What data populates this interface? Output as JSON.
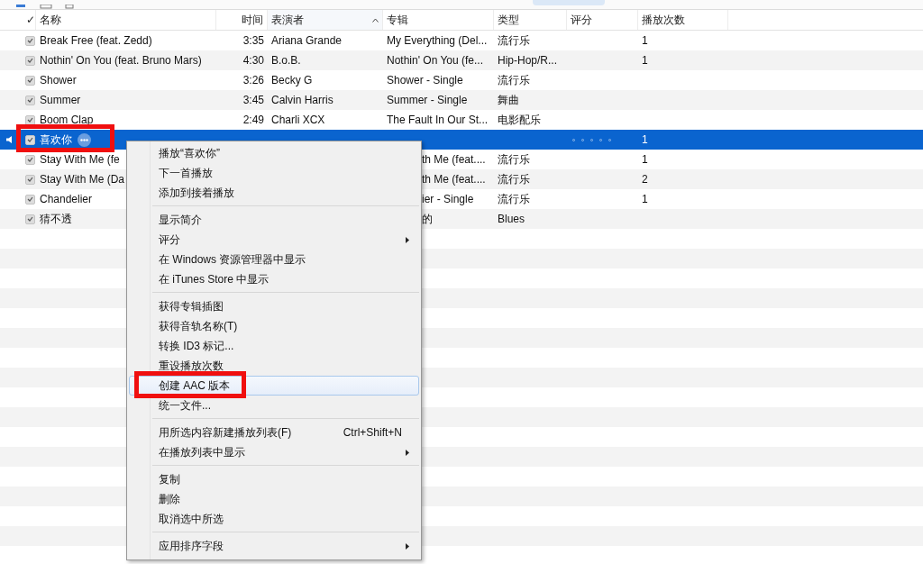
{
  "table": {
    "columns": [
      {
        "label": "✓"
      },
      {
        "label": "名称",
        "sorted": false
      },
      {
        "label": "时间",
        "sorted": false
      },
      {
        "label": "表演者",
        "sorted": true
      },
      {
        "label": "专辑",
        "sorted": false
      },
      {
        "label": "类型",
        "sorted": false
      },
      {
        "label": "评分",
        "sorted": false
      },
      {
        "label": "播放次数",
        "sorted": false
      }
    ],
    "rows": [
      {
        "checked": true,
        "selected": false,
        "playing": false,
        "highlighted": false,
        "name": "Break Free (feat. Zedd)",
        "time": "3:35",
        "artist": "Ariana Grande",
        "album": "My Everything (Del...",
        "genre": "流行乐",
        "plays": "1"
      },
      {
        "checked": true,
        "selected": false,
        "playing": false,
        "highlighted": false,
        "name": "Nothin' On You (feat. Bruno Mars)",
        "time": "4:30",
        "artist": "B.o.B.",
        "album": "Nothin' On You (fe...",
        "genre": "Hip-Hop/R...",
        "plays": "1"
      },
      {
        "checked": true,
        "selected": false,
        "playing": false,
        "highlighted": false,
        "name": "Shower",
        "time": "3:26",
        "artist": "Becky G",
        "album": "Shower - Single",
        "genre": "流行乐"
      },
      {
        "checked": true,
        "selected": false,
        "playing": false,
        "highlighted": false,
        "name": "Summer",
        "time": "3:45",
        "artist": "Calvin Harris",
        "album": "Summer - Single",
        "genre": "舞曲"
      },
      {
        "checked": true,
        "selected": false,
        "playing": false,
        "highlighted": false,
        "name": "Boom Clap",
        "time": "2:49",
        "artist": "Charli XCX",
        "album": "The Fault In Our St...",
        "genre": "电影配乐"
      },
      {
        "checked": true,
        "selected": true,
        "playing": true,
        "highlighted": true,
        "name": "喜欢你",
        "stars": 0,
        "plays": "1"
      },
      {
        "checked": true,
        "selected": false,
        "playing": false,
        "highlighted": false,
        "name": "Stay With Me (fe",
        "album": "th Me (feat....",
        "genre": "流行乐",
        "plays": "1"
      },
      {
        "checked": true,
        "selected": false,
        "playing": false,
        "highlighted": false,
        "name": "Stay With Me (Da",
        "album": "th Me (feat....",
        "genre": "流行乐",
        "plays": "2"
      },
      {
        "checked": true,
        "selected": false,
        "playing": false,
        "highlighted": false,
        "name": "Chandelier",
        "album": "ier - Single",
        "genre": "流行乐",
        "plays": "1"
      },
      {
        "checked": true,
        "selected": false,
        "playing": false,
        "highlighted": false,
        "name": "猜不透",
        "album": "的",
        "genre": "Blues"
      }
    ]
  },
  "context_menu": {
    "groups": [
      [
        {
          "label": "播放“喜欢你”",
          "submenu": false,
          "hovered": false,
          "highlighted": false
        },
        {
          "label": "下一首播放",
          "submenu": false,
          "hovered": false,
          "highlighted": false
        },
        {
          "label": "添加到接着播放",
          "submenu": false,
          "hovered": false,
          "highlighted": false
        }
      ],
      [
        {
          "label": "显示简介",
          "submenu": false,
          "hovered": false,
          "highlighted": false
        },
        {
          "label": "评分",
          "submenu": true,
          "hovered": false,
          "highlighted": false
        },
        {
          "label": "在 Windows 资源管理器中显示",
          "submenu": false,
          "hovered": false,
          "highlighted": false
        },
        {
          "label": "在 iTunes Store 中显示",
          "submenu": false,
          "hovered": false,
          "highlighted": false
        }
      ],
      [
        {
          "label": "获得专辑插图",
          "submenu": false,
          "hovered": false,
          "highlighted": false
        },
        {
          "label": "获得音轨名称(T)",
          "submenu": false,
          "hovered": false,
          "highlighted": false
        },
        {
          "label": "转换 ID3 标记...",
          "submenu": false,
          "hovered": false,
          "highlighted": false
        },
        {
          "label": "重设播放次数",
          "submenu": false,
          "hovered": false,
          "highlighted": false
        },
        {
          "label": "创建 AAC 版本",
          "submenu": false,
          "hovered": true,
          "highlighted": true
        },
        {
          "label": "统一文件...",
          "submenu": false,
          "hovered": false,
          "highlighted": false
        }
      ],
      [
        {
          "label": "用所选内容新建播放列表(F)",
          "shortcut": "Ctrl+Shift+N",
          "submenu": false,
          "hovered": false,
          "highlighted": false
        },
        {
          "label": "在播放列表中显示",
          "submenu": true,
          "hovered": false,
          "highlighted": false
        }
      ],
      [
        {
          "label": "复制",
          "submenu": false,
          "hovered": false,
          "highlighted": false
        },
        {
          "label": "删除",
          "submenu": false,
          "hovered": false,
          "highlighted": false
        },
        {
          "label": "取消选中所选",
          "submenu": false,
          "hovered": false,
          "highlighted": false
        }
      ],
      [
        {
          "label": "应用排序字段",
          "submenu": true,
          "hovered": false,
          "highlighted": false
        }
      ]
    ]
  }
}
